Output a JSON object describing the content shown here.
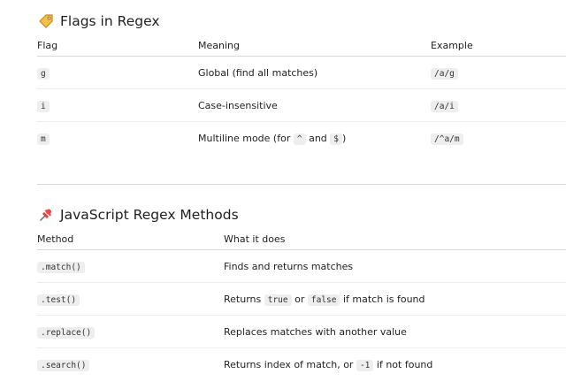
{
  "flags_section": {
    "emoji": "label-tag-icon",
    "title": "Flags in Regex",
    "headers": {
      "flag": "Flag",
      "meaning": "Meaning",
      "example": "Example"
    },
    "rows": [
      {
        "flag": "g",
        "meaning": "Global (find all matches)",
        "example": "/a/g"
      },
      {
        "flag": "i",
        "meaning": "Case-insensitive",
        "example": "/a/i"
      },
      {
        "flag": "m",
        "meaning_prefix": "Multiline mode (for ",
        "code1": "^",
        "and": " and ",
        "code2": "$",
        "meaning_suffix": ")",
        "example": "/^a/m"
      }
    ]
  },
  "methods_section": {
    "emoji": "pushpin-icon",
    "title": "JavaScript Regex Methods",
    "headers": {
      "method": "Method",
      "what": "What it does"
    },
    "rows": [
      {
        "method": ".match()",
        "desc": "Finds and returns matches"
      },
      {
        "method": ".test()",
        "desc_prefix": "Returns ",
        "code1": "true",
        "mid": " or ",
        "code2": "false",
        "desc_suffix": " if match is found"
      },
      {
        "method": ".replace()",
        "desc": "Replaces matches with another value"
      },
      {
        "method": ".search()",
        "desc_prefix": "Returns index of match, or ",
        "code1": "-1",
        "desc_suffix": " if not found"
      }
    ]
  }
}
